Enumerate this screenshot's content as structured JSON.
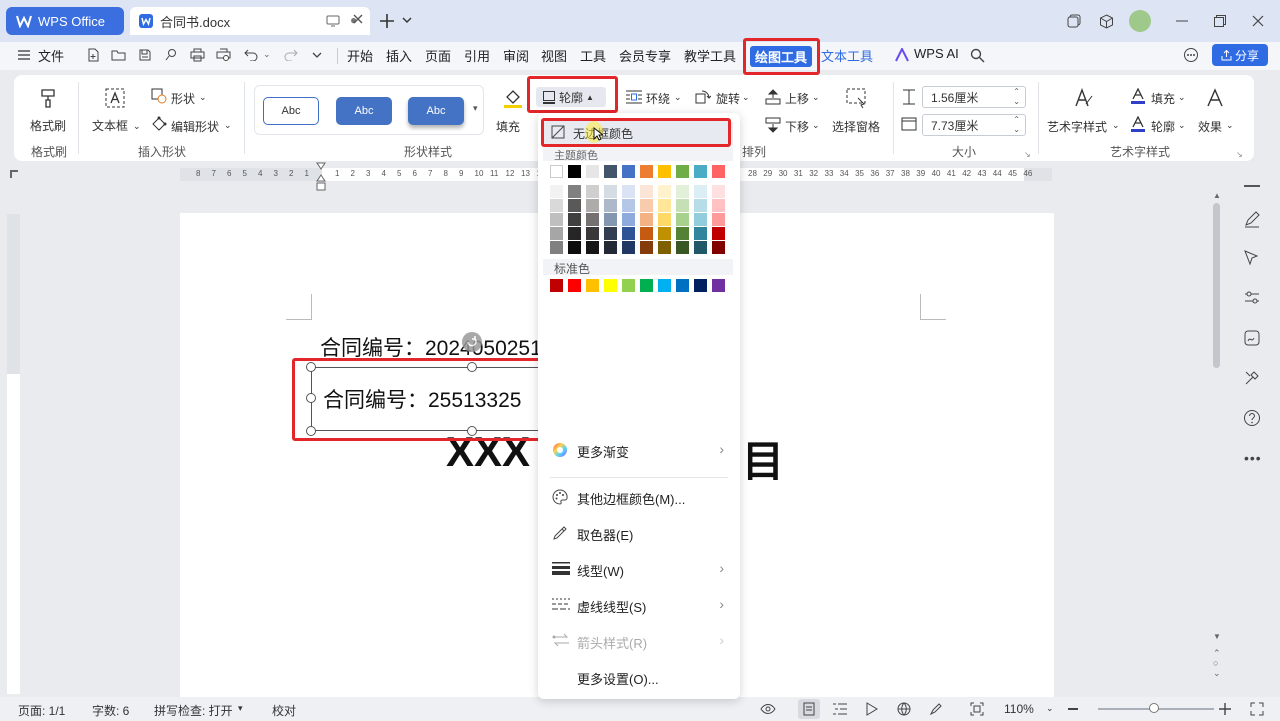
{
  "titlebar": {
    "app_label": "WPS Office",
    "doc_name": "合同书.docx"
  },
  "menubar": {
    "file": "文件",
    "tabs": [
      "开始",
      "插入",
      "页面",
      "引用",
      "审阅",
      "视图",
      "工具",
      "会员专享",
      "教学工具",
      "绘图工具",
      "文本工具"
    ],
    "ai": "WPS AI",
    "share": "分享"
  },
  "ribbon": {
    "format_brush": "格式刷",
    "format_brush_group": "格式刷",
    "textbox": "文本框",
    "shape": "形状",
    "edit_shape": "编辑形状",
    "insert_shape_group": "插入形状",
    "abc": "Abc",
    "shape_style_group": "形状样式",
    "fill": "填充",
    "outline": "轮廓",
    "wrap": "环绕",
    "rotate": "旋转",
    "bring_forward": "上移",
    "send_backward": "下移",
    "selection_pane": "选择窗格",
    "arrange_group": "排列",
    "height": "1.56厘米",
    "width": "7.73厘米",
    "size_group": "大小",
    "art_style": "艺术字样式",
    "text_fill": "填充",
    "text_outline": "轮廓",
    "effects": "效果",
    "art_group": "艺术字样式"
  },
  "ruler": {
    "left_ticks": [
      "8",
      "7",
      "6",
      "5",
      "4",
      "3",
      "2",
      "1"
    ],
    "right_ticks": [
      "1",
      "2",
      "3",
      "4",
      "5",
      "6",
      "7",
      "8",
      "9",
      "10",
      "11",
      "12",
      "13",
      "14"
    ],
    "far_ticks": [
      "28",
      "29",
      "30",
      "31",
      "32",
      "33",
      "34",
      "35",
      "36",
      "37",
      "38",
      "39",
      "40",
      "41",
      "42",
      "43",
      "44",
      "45",
      "46"
    ]
  },
  "document": {
    "line1": "合同编号：2024050251",
    "textbox_text": "合同编号：25513325",
    "heading_left": "XXX",
    "heading_right": "目"
  },
  "dropdown": {
    "no_border": "无边框颜色",
    "theme_colors": "主题颜色",
    "standard_colors": "标准色",
    "more_gradient": "更多渐变",
    "other_border": "其他边框颜色(M)...",
    "eyedropper": "取色器(E)",
    "line_type": "线型(W)",
    "dash_type": "虚线线型(S)",
    "arrow_style": "箭头样式(R)",
    "more_settings": "更多设置(O)...",
    "theme_top_row": [
      "#ffffff",
      "#000000",
      "#e7e6e6",
      "#44546a",
      "#4472c4",
      "#ed7d31",
      "#ffc000",
      "#70ad47",
      "#4bacc6",
      "#ff6464"
    ],
    "theme_columns": [
      [
        "#f2f2f2",
        "#d9d9d9",
        "#bfbfbf",
        "#a6a6a6",
        "#808080"
      ],
      [
        "#808080",
        "#595959",
        "#404040",
        "#262626",
        "#0d0d0d"
      ],
      [
        "#d0cece",
        "#aeabab",
        "#757171",
        "#3a3838",
        "#171616"
      ],
      [
        "#d6dce4",
        "#adb9ca",
        "#8497b0",
        "#333f50",
        "#222a35"
      ],
      [
        "#dae3f3",
        "#b4c7e7",
        "#8faadc",
        "#2f5597",
        "#1f3864"
      ],
      [
        "#fbe5d6",
        "#f8cbad",
        "#f4b183",
        "#c55a11",
        "#843c0c"
      ],
      [
        "#fff2cc",
        "#ffe699",
        "#ffd966",
        "#bf9000",
        "#7f6000"
      ],
      [
        "#e2f0d9",
        "#c5e0b4",
        "#a9d18e",
        "#548235",
        "#385723"
      ],
      [
        "#daeef3",
        "#b7dee8",
        "#92cddc",
        "#31859c",
        "#215968"
      ],
      [
        "#ffe0e0",
        "#ffc1c1",
        "#ff9a9a",
        "#c00000",
        "#800000"
      ]
    ],
    "standard_row": [
      "#c00000",
      "#ff0000",
      "#ffc000",
      "#ffff00",
      "#92d050",
      "#00b050",
      "#00b0f0",
      "#0070c0",
      "#002060",
      "#7030a0"
    ]
  },
  "statusbar": {
    "page": "页面: 1/1",
    "words": "字数: 6",
    "spell": "拼写检查: 打开",
    "proof": "校对",
    "zoom": "110%"
  }
}
